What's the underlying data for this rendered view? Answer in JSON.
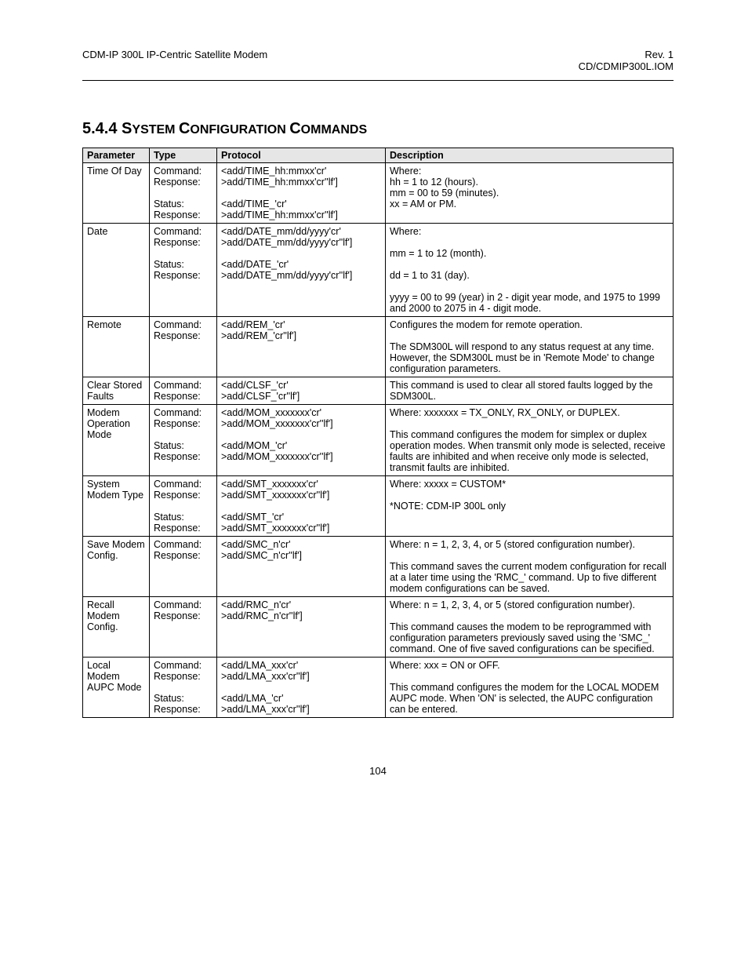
{
  "header": {
    "left": "CDM-IP 300L IP-Centric Satellite Modem",
    "right_top": "Rev. 1",
    "right_bottom": "CD/CDMIP300L.IOM"
  },
  "section": {
    "number": "5.4.4",
    "title_small": "S",
    "title_rest": "ystem ",
    "title_c": "C",
    "title_rest2": "onfiguration ",
    "title_c2": "C",
    "title_rest3": "ommands",
    "full_title": "5.4.4 SYSTEM CONFIGURATION COMMANDS"
  },
  "table": {
    "headers": [
      "Parameter",
      "Type",
      "Protocol",
      "Description"
    ],
    "rows": [
      {
        "parameter": "Time Of Day",
        "type_block1": [
          "Command:",
          "Response:"
        ],
        "type_block2": [
          "Status:",
          "Response:"
        ],
        "proto_block1": [
          "<add/TIME_hh:mmxx'cr'",
          ">add/TIME_hh:mmxx'cr''lf']"
        ],
        "proto_block2": [
          "<add/TIME_'cr'",
          ">add/TIME_hh:mmxx'cr''lf']"
        ],
        "desc": [
          "Where:",
          "hh = 1 to 12 (hours).",
          "mm = 00 to 59 (minutes).",
          "xx = AM or PM."
        ]
      },
      {
        "parameter": "Date",
        "type_block1": [
          "Command:",
          "Response:"
        ],
        "type_block2": [
          "Status:",
          "Response:"
        ],
        "proto_block1": [
          "<add/DATE_mm/dd/yyyy'cr'",
          ">add/DATE_mm/dd/yyyy'cr''lf']"
        ],
        "proto_block2": [
          "<add/DATE_'cr'",
          ">add/DATE_mm/dd/yyyy'cr''lf']"
        ],
        "desc_blocks": [
          [
            "Where:"
          ],
          [
            "mm = 1 to 12 (month)."
          ],
          [
            "dd = 1 to 31 (day)."
          ],
          [
            "yyyy = 00 to 99 (year) in 2 - digit year mode, and 1975 to 1999 and 2000 to 2075 in 4 - digit mode."
          ]
        ]
      },
      {
        "parameter": "Remote",
        "type_block1": [
          "Command:",
          "Response:"
        ],
        "proto_block1": [
          "<add/REM_'cr'",
          ">add/REM_'cr''lf']"
        ],
        "desc_blocks": [
          [
            "Configures the modem for remote operation."
          ],
          [
            "The SDM300L will respond to any status request at any time. However, the SDM300L must be in 'Remote Mode' to change configuration parameters."
          ]
        ]
      },
      {
        "parameter": "Clear Stored Faults",
        "type_block1": [
          "Command:",
          "Response:"
        ],
        "proto_block1": [
          "<add/CLSF_'cr'",
          ">add/CLSF_'cr''lf']"
        ],
        "desc": [
          "This command is used to clear all stored faults logged by the SDM300L."
        ]
      },
      {
        "parameter": "Modem Operation Mode",
        "type_block1": [
          "Command:",
          "Response:"
        ],
        "type_block2": [
          "Status:",
          "Response:"
        ],
        "proto_block1": [
          "<add/MOM_xxxxxxx'cr'",
          ">add/MOM_xxxxxxx'cr''lf']"
        ],
        "proto_block2": [
          "<add/MOM_'cr'",
          ">add/MOM_xxxxxxx'cr''lf']"
        ],
        "desc_blocks": [
          [
            "Where: xxxxxxx = TX_ONLY, RX_ONLY, or DUPLEX."
          ],
          [
            "This command configures the modem for simplex or duplex operation modes. When transmit only mode is selected, receive faults are inhibited and when receive only mode is selected, transmit faults are inhibited."
          ]
        ]
      },
      {
        "parameter": "System Modem Type",
        "type_block1": [
          "Command:",
          "Response:"
        ],
        "type_block2": [
          "Status:",
          "Response:"
        ],
        "proto_block1": [
          "<add/SMT_xxxxxxx'cr'",
          ">add/SMT_xxxxxxx'cr''lf']"
        ],
        "proto_block2": [
          "<add/SMT_'cr'",
          ">add/SMT_xxxxxxx'cr''lf']"
        ],
        "desc_blocks": [
          [
            "Where: xxxxx = CUSTOM*"
          ],
          [
            ""
          ],
          [
            "*NOTE: CDM-IP 300L only"
          ]
        ]
      },
      {
        "parameter": "Save Modem Config.",
        "type_block1": [
          "Command:",
          "Response:"
        ],
        "proto_block1": [
          "<add/SMC_n'cr'",
          ">add/SMC_n'cr''lf']"
        ],
        "desc_blocks": [
          [
            "Where: n = 1, 2, 3, 4, or 5 (stored configuration number)."
          ],
          [
            "This command saves the current modem configuration for recall at a later time using the 'RMC_' command. Up to five different modem configurations can be saved."
          ]
        ]
      },
      {
        "parameter": "Recall Modem Config.",
        "type_block1": [
          "Command:",
          "Response:"
        ],
        "proto_block1": [
          "<add/RMC_n'cr'",
          ">add/RMC_n'cr''lf']"
        ],
        "desc_blocks": [
          [
            "Where: n = 1, 2, 3, 4, or 5 (stored configuration number)."
          ],
          [
            "This command causes the modem to be reprogrammed with configuration parameters previously saved using the 'SMC_' command. One of five saved configurations can be specified."
          ]
        ]
      },
      {
        "parameter": "Local Modem AUPC Mode",
        "type_block1": [
          "Command:",
          "Response:"
        ],
        "type_block2": [
          "Status:",
          "Response:"
        ],
        "proto_block1": [
          "<add/LMA_xxx'cr'",
          ">add/LMA_xxx'cr''lf']"
        ],
        "proto_block2": [
          "<add/LMA_'cr'",
          ">add/LMA_xxx'cr''lf']"
        ],
        "desc_blocks": [
          [
            "Where: xxx = ON or OFF."
          ],
          [
            "This command configures the modem for the LOCAL MODEM AUPC mode. When 'ON' is selected, the AUPC configuration can be entered."
          ]
        ]
      }
    ]
  },
  "page_number": "104"
}
